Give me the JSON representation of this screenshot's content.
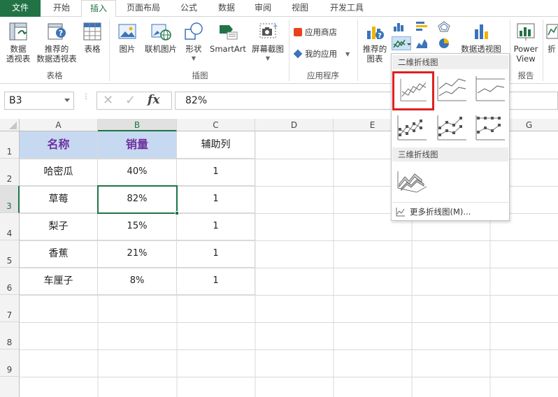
{
  "ribbon_tabs": [
    {
      "label": "文件"
    },
    {
      "label": "开始"
    },
    {
      "label": "插入"
    },
    {
      "label": "页面布局"
    },
    {
      "label": "公式"
    },
    {
      "label": "数据"
    },
    {
      "label": "审阅"
    },
    {
      "label": "视图"
    },
    {
      "label": "开发工具"
    }
  ],
  "ribbon": {
    "pivot_label1": "数据",
    "pivot_label2": "透视表",
    "rec_pivot_label1": "推荐的",
    "rec_pivot_label2": "数据透视表",
    "table_label": "表格",
    "group_tables": "表格",
    "picture_label": "图片",
    "online_picture_label": "联机图片",
    "shapes_label": "形状",
    "smartart_label": "SmartArt",
    "screenshot_label": "屏幕截图",
    "group_illustrations": "插图",
    "app_store_label": "应用商店",
    "my_apps_label": "我的应用",
    "group_apps": "应用程序",
    "rec_charts_label1": "推荐的",
    "rec_charts_label2": "图表",
    "pivot_chart_label": "数据透视图",
    "power_view_label1": "Power",
    "power_view_label2": "View",
    "group_reports": "报告",
    "sparkline_label": "折"
  },
  "formula_bar": {
    "name_box": "B3",
    "fx": "fx",
    "value": "82%"
  },
  "sheet": {
    "columns": [
      "A",
      "B",
      "C",
      "D",
      "E",
      "F",
      "G"
    ],
    "rows": [
      "1",
      "2",
      "3",
      "4",
      "5",
      "6",
      "7",
      "8",
      "9"
    ],
    "header": [
      "名称",
      "销量",
      "辅助列"
    ],
    "data": [
      [
        "哈密瓜",
        "40%",
        "1"
      ],
      [
        "草莓",
        "82%",
        "1"
      ],
      [
        "梨子",
        "15%",
        "1"
      ],
      [
        "香蕉",
        "21%",
        "1"
      ],
      [
        "车厘子",
        "8%",
        "1"
      ]
    ]
  },
  "gallery": {
    "section_2d": "二维折线图",
    "section_3d": "三维折线图",
    "more": "更多折线图(M)..."
  },
  "colors": {
    "excel_green": "#217346",
    "header_fill": "#c6d9f0",
    "header_text": "#7030a0",
    "highlight": "#e02020"
  }
}
